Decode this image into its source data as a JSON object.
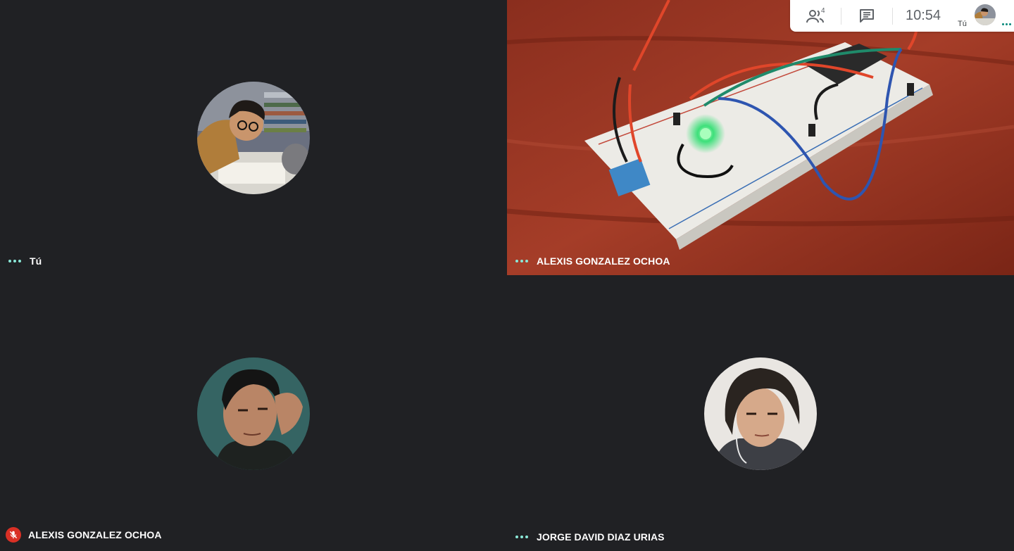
{
  "app": {
    "accent_color": "#8ae8d8",
    "background_color": "#202124",
    "muted_color": "#d93025"
  },
  "tiles": [
    {
      "name": "Tú",
      "status_icon": "more-dots-icon",
      "media": "avatar"
    },
    {
      "name": "ALEXIS GONZALEZ OCHOA",
      "status_icon": "more-dots-icon",
      "media": "video"
    },
    {
      "name": "ALEXIS GONZALEZ OCHOA",
      "status_icon": "mic-off-icon",
      "media": "avatar"
    },
    {
      "name": "JORGE DAVID DIAZ URIAS",
      "status_icon": "more-dots-icon",
      "media": "avatar"
    }
  ],
  "topbar": {
    "people_icon": "people-icon",
    "people_count": "4",
    "chat_icon": "chat-icon",
    "time": "10:54",
    "self_label": "Tú",
    "self_status_icon": "more-dots-icon"
  }
}
